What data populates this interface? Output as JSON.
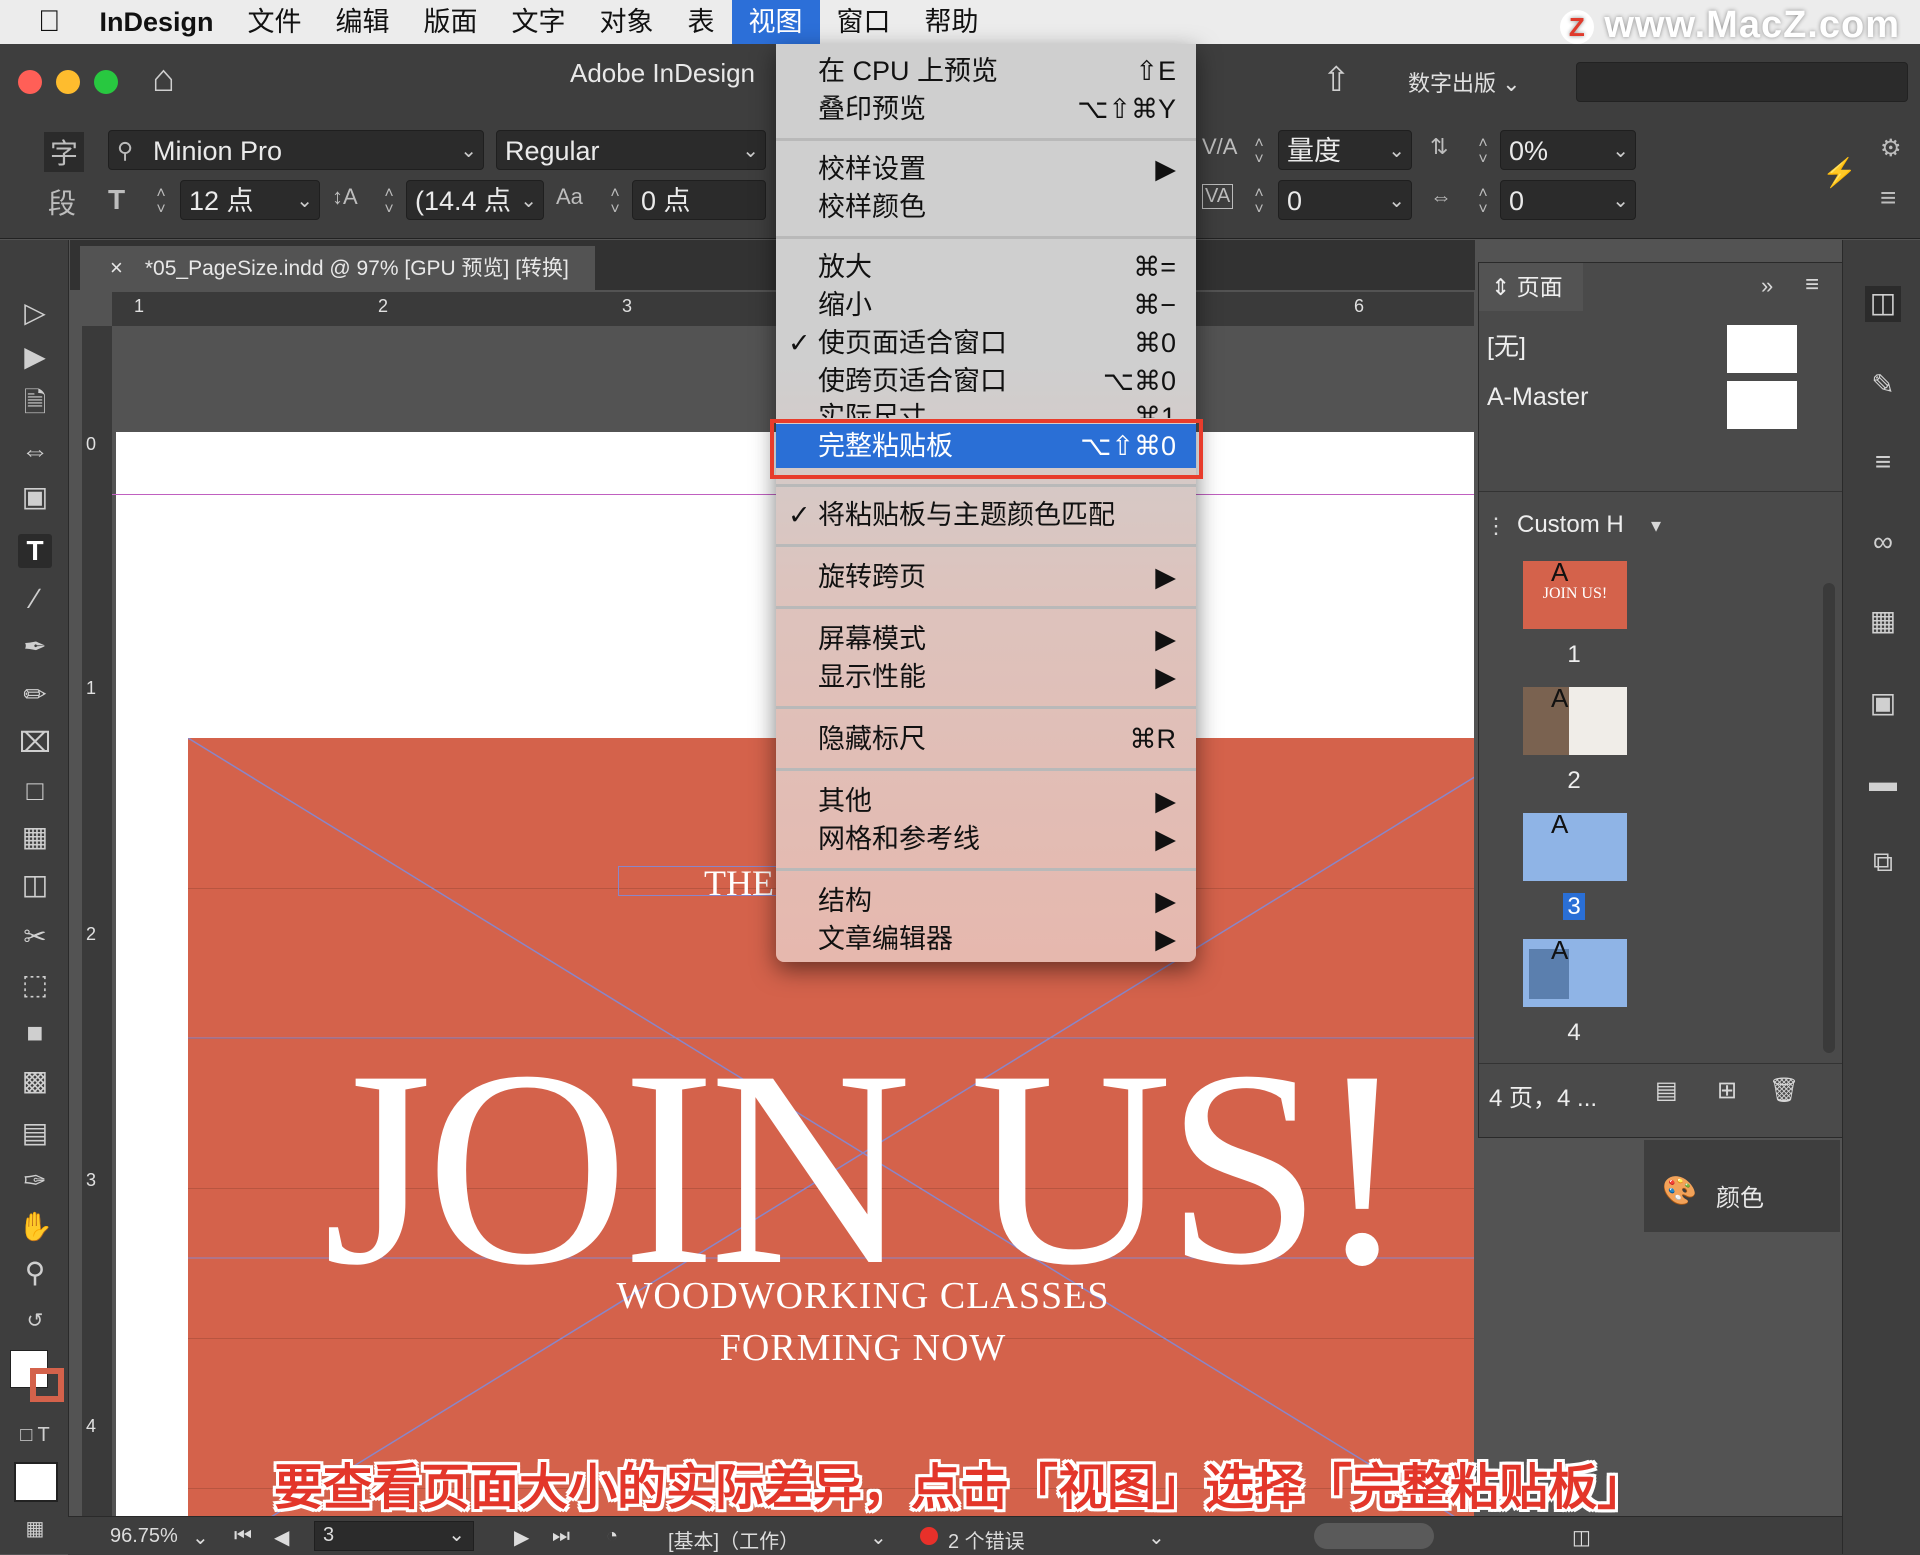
{
  "menubar": {
    "apple": "",
    "app": "InDesign",
    "items": [
      "文件",
      "编辑",
      "版面",
      "文字",
      "对象",
      "表",
      "视图",
      "窗口",
      "帮助"
    ],
    "active": "视图"
  },
  "watermark": "www.MacZ.com",
  "titlebar": {
    "title": "Adobe InDesign",
    "publish_mode": "数字出版"
  },
  "control": {
    "char_mode": "字",
    "para_mode": "段",
    "font_family": "Minion Pro",
    "font_style": "Regular",
    "font_size": "12 点",
    "leading": "(14.4 点",
    "baseline_shift": "0 点",
    "kerning": "量度",
    "kerning_value": "0",
    "tracking": "0%",
    "tracking_value": "0"
  },
  "doc_tab": {
    "close": "×",
    "title": "*05_PageSize.indd @ 97% [GPU 预览] [转换]"
  },
  "ruler": {
    "h": [
      "1",
      "2",
      "3",
      "6"
    ],
    "v": [
      "0",
      "1",
      "2",
      "3",
      "4"
    ]
  },
  "poster": {
    "the": "THE",
    "headline": "JOIN US!",
    "line1": "WOODWORKING CLASSES",
    "line2": "FORMING NOW",
    "color": "#d4624b"
  },
  "view_menu": {
    "items": [
      {
        "label": "在 CPU 上预览",
        "shortcut": "⇧E"
      },
      {
        "label": "叠印预览",
        "shortcut": "⌥⇧⌘Y"
      },
      {
        "label": "校样设置",
        "shortcut": "▶"
      },
      {
        "label": "校样颜色",
        "shortcut": ""
      },
      {
        "label": "放大",
        "shortcut": "⌘="
      },
      {
        "label": "缩小",
        "shortcut": "⌘−"
      },
      {
        "label": "使页面适合窗口",
        "shortcut": "⌘0",
        "checked": true
      },
      {
        "label": "使跨页适合窗口",
        "shortcut": "⌥⌘0"
      },
      {
        "label": "实际尺寸",
        "shortcut": "⌘1"
      },
      {
        "label": "完整粘贴板",
        "shortcut": "⌥⇧⌘0",
        "highlighted": true
      },
      {
        "label": "将粘贴板与主题颜色匹配",
        "shortcut": "",
        "checked": true
      },
      {
        "label": "旋转跨页",
        "shortcut": "▶"
      },
      {
        "label": "屏幕模式",
        "shortcut": "▶"
      },
      {
        "label": "显示性能",
        "shortcut": "▶"
      },
      {
        "label": "隐藏标尺",
        "shortcut": "⌘R"
      },
      {
        "label": "其他",
        "shortcut": "▶"
      },
      {
        "label": "网格和参考线",
        "shortcut": "▶"
      },
      {
        "label": "结构",
        "shortcut": "▶"
      },
      {
        "label": "文章编辑器",
        "shortcut": "▶"
      }
    ],
    "checkmark": "✓"
  },
  "pages_panel": {
    "tab": "页面",
    "masters": [
      "[无]",
      "A-Master"
    ],
    "view": "Custom H",
    "pages": [
      "1",
      "2",
      "3",
      "4"
    ],
    "thumb_letter": "A",
    "footer": "4 页，4 ..."
  },
  "color_panel": {
    "label": "颜色"
  },
  "status": {
    "zoom": "96.75%",
    "page": "3",
    "profile": "[基本]（工作）",
    "errors": "2 个错误",
    "error_color": "#e8302a"
  },
  "caption": "要查看页面大小的实际差异，点击「视图」选择「完整粘贴板」"
}
